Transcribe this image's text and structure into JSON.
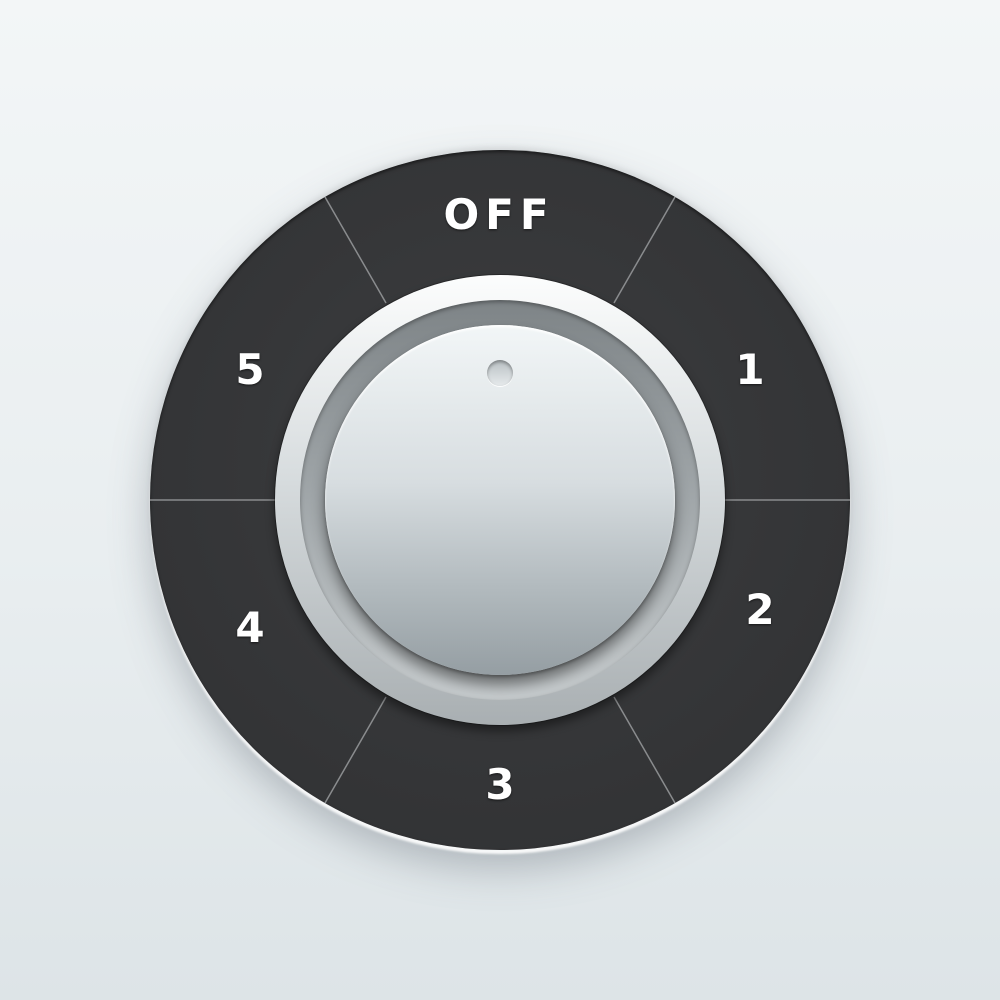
{
  "dial": {
    "options": [
      {
        "label": "OFF"
      },
      {
        "label": "1"
      },
      {
        "label": "2"
      },
      {
        "label": "3"
      },
      {
        "label": "4"
      },
      {
        "label": "5"
      }
    ],
    "selected": "OFF"
  },
  "colors": {
    "background": "#eef2f3",
    "ring": "#363739",
    "label": "#ffffff",
    "divider": "#8a8c8e",
    "knob": "#c9d0d3"
  },
  "icons": {
    "indicator": "knob-indicator-dot"
  }
}
